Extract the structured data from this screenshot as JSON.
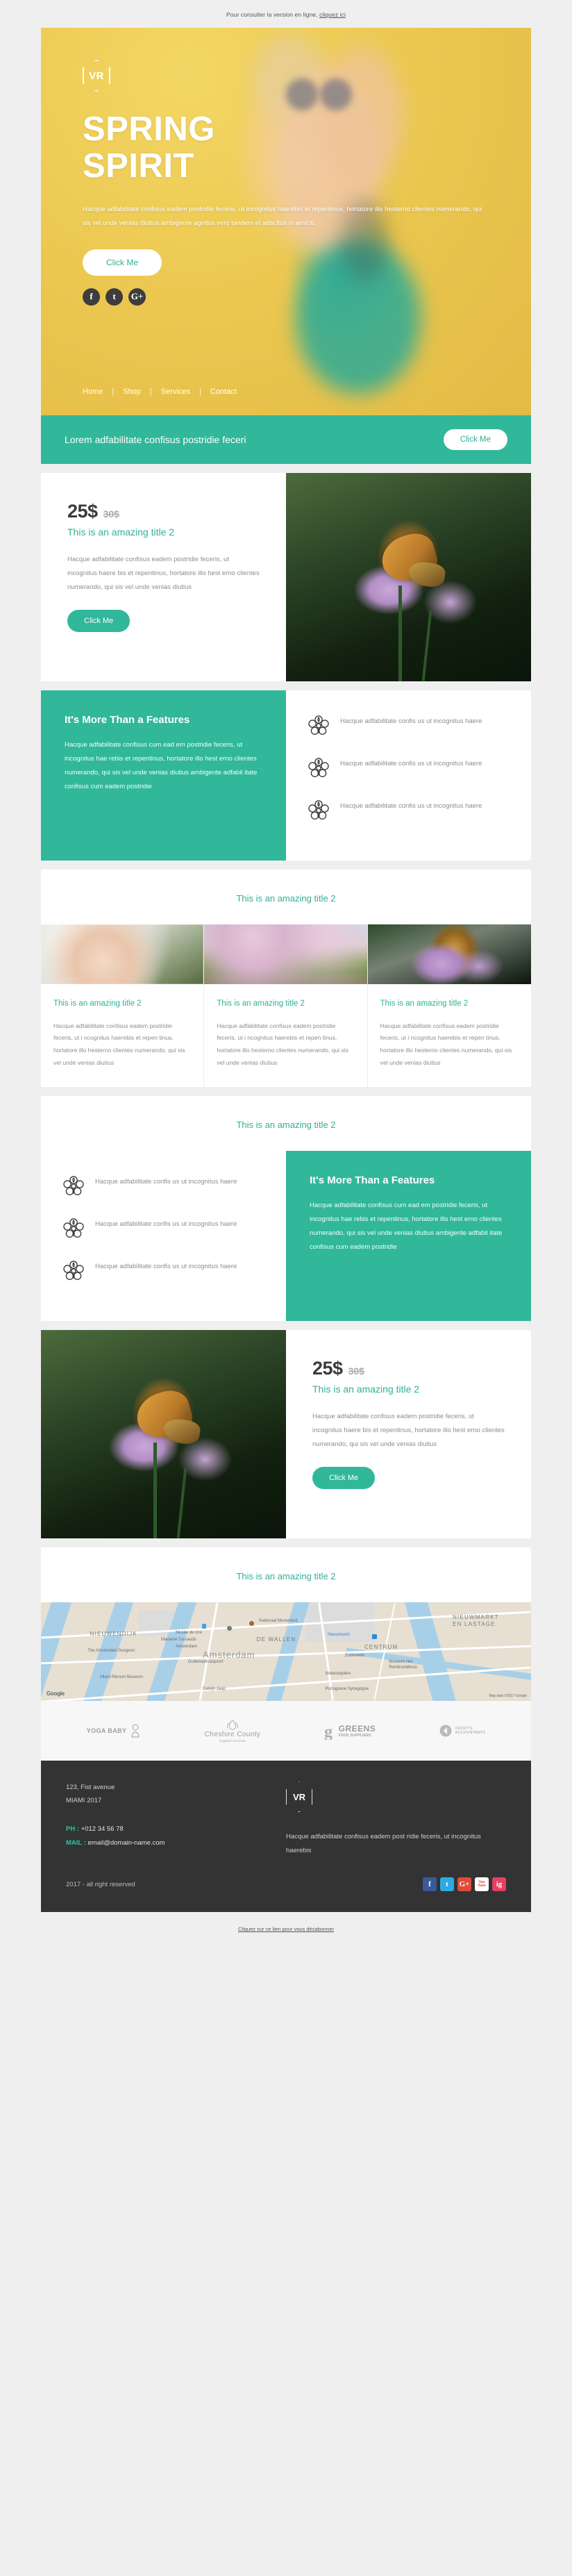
{
  "preheader": {
    "text": "Pour consulter la version en ligne, ",
    "link": "cliquez ici"
  },
  "brand": {
    "logo": "VR",
    "accent": "#31b79a",
    "yellow": "#ecc851",
    "dark": "#333333"
  },
  "hero": {
    "title_line1": "SPRING",
    "title_line2": "SPIRIT",
    "paragraph": "Hacque adfabilitate confisus eadem postridie feceris, ut incognitus haerebis et repentinus, hortatore illo hesterno clientes numerando, qui sis vel unde venias diutius ambigente agnitus vero tandem et adscitus in amiciti.",
    "button": "Click Me",
    "socials": [
      "f",
      "t",
      "G+"
    ],
    "nav": [
      "Home",
      "Shop",
      "Services",
      "Contact"
    ]
  },
  "cta_band": {
    "text": "Lorem adfabilitate confisus postridie feceri",
    "button": "Click Me"
  },
  "price_block_1": {
    "price": "25$",
    "old_price": "30$",
    "subtitle": "This is an amazing title 2",
    "paragraph": "Hacque adfabilitate confisus eadem postridie feceris, ut incognitus haere bis et repentinus, hortatore illo hest erno clientes numerando, qui sis vel unde venias diutius",
    "button": "Click Me"
  },
  "features_block_1": {
    "title": "It's More Than a Features",
    "paragraph": "Hacque adfabilitate confisus cum ead em postridie feceris, ut incognitus hae rebis et repentinus, hortatore illo hest erno clientes numerando, qui sis vel unde venias diutius ambigente adfabil itate confisus cum eadem postridie",
    "items": [
      "Hacque adfabilitate confis us ut incognitus haere",
      "Hacque adfabilitate confis us ut incognitus haere",
      "Hacque adfabilitate confis us ut incognitus haere"
    ]
  },
  "section_title_1": "This is an amazing title 2",
  "three_columns": [
    {
      "title": "This is an amazing title 2",
      "paragraph": "Hacque adfabilitate confisus eadem postridie feceris, ut i ncognitus haerebis et repen tinus, hortatore illo hesterno clientes numerando, qui sis vel unde venias diutius",
      "image": "hand-holding-flowers"
    },
    {
      "title": "This is an amazing title 2",
      "paragraph": "Hacque adfabilitate confisus eadem postridie feceris, ut i ncognitus haerebis et repen tinus, hortatore illo hesterno clientes numerando, qui sis vel unde venias diutius",
      "image": "woman-photographing-cherry-blossom"
    },
    {
      "title": "This is an amazing title 2",
      "paragraph": "Hacque adfabilitate confisus eadem postridie feceris, ut i ncognitus haerebis et repen tinus, hortatore illo hesterno clientes numerando, qui sis vel unde venias diutius",
      "image": "butterfly-on-purple-flowers"
    }
  ],
  "section_title_2": "This is an amazing title 2",
  "features_block_2": {
    "title": "It's More Than a Features",
    "paragraph": "Hacque adfabilitate confisus cum ead em postridie feceris, ut incognitus hae rebis et repentinus, hortatore illo hest erno clientes numerando, qui sis vel unde venias diutius ambigente adfabil itate confisus cum eadem postridie",
    "items": [
      "Hacque adfabilitate confis us ut incognitus haere",
      "Hacque adfabilitate confis us ut incognitus haere",
      "Hacque adfabilitate confis us ut incognitus haere"
    ]
  },
  "price_block_2": {
    "price": "25$",
    "old_price": "30$",
    "subtitle": "This is an amazing title 2",
    "paragraph": "Hacque adfabilitate confisus eadem postridie feceris, ut incognitus haere bis et repentinus, hortatore illo hest erno clientes numerando, qui sis vel unde venias diutius",
    "button": "Click Me"
  },
  "section_title_3": "This is an amazing title 2",
  "map": {
    "city": "Amsterdam",
    "labels": [
      "Nationaal Monument",
      "Musée de cire",
      "Madame Tussauds",
      "Amsterdam",
      "DE WALLEN",
      "Nieuwmarkt",
      "NIEUWMARKT",
      "EN LASTAGE",
      "CENTRUM",
      "NIEUWENDIJK",
      "The Amsterdam Dungeon",
      "Oudemanhuispoort",
      "Zuiderkerk",
      "Museum Het",
      "Rembrandthuis",
      "Waterlooplein",
      "Allard Pierson Museum",
      "Portuguese Synagogue",
      "Calvijn Jaap"
    ],
    "attribution": "Map data ©2017 Google",
    "google": "Google"
  },
  "partner_logos": [
    {
      "name": "YOGA BABY",
      "sub": ""
    },
    {
      "name": "Cheshire County",
      "sub": "Hygiene Services"
    },
    {
      "name": "GREENS",
      "sub": "FOOD SUPPLIERS"
    },
    {
      "name": "CROFT'S",
      "sub": "ACCOUNTANTS"
    }
  ],
  "footer": {
    "address_line1": "123, Fist avenue",
    "address_line2": "MIAMI 2017",
    "phone_label": "PH :",
    "phone_value": " +012 34 56 78",
    "mail_label": "MAIL :",
    "mail_value": " email@domain-name.com",
    "logo": "VR",
    "paragraph": "Hacque adfabilitate confisus eadem post ridie feceris, ut incognitus haerebis",
    "copyright": "2017 - all right reserved",
    "socials": [
      "f",
      "t",
      "G+",
      "You Tube",
      "ig"
    ]
  },
  "unsubscribe": "Cliquez sur ce lien pour vous désabonner"
}
